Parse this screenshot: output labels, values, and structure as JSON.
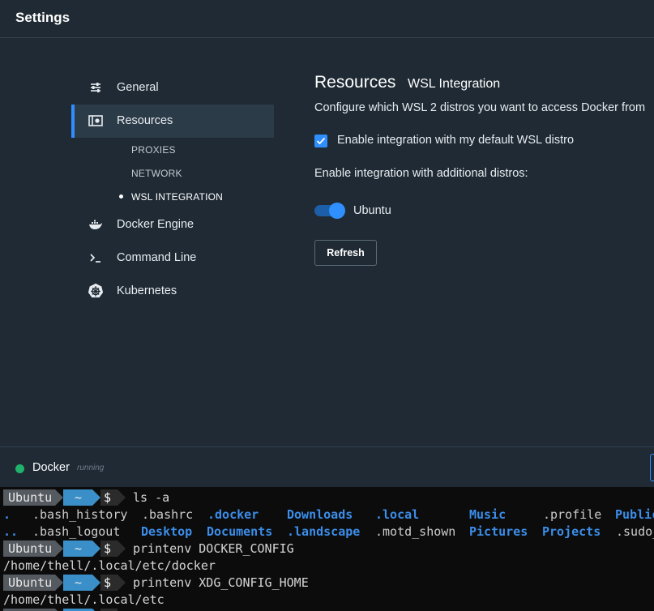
{
  "window": {
    "title": "Settings"
  },
  "sidebar": {
    "items": [
      {
        "label": "General",
        "icon": "sliders-icon"
      },
      {
        "label": "Resources",
        "icon": "resources-icon",
        "active": true
      },
      {
        "label": "Docker Engine",
        "icon": "whale-icon"
      },
      {
        "label": "Command Line",
        "icon": "terminal-prompt-icon"
      },
      {
        "label": "Kubernetes",
        "icon": "kubernetes-helm-icon"
      }
    ],
    "subitems": [
      {
        "label": "PROXIES"
      },
      {
        "label": "NETWORK"
      },
      {
        "label": "WSL INTEGRATION",
        "current": true
      }
    ]
  },
  "main": {
    "title": "Resources",
    "subtitle": "WSL Integration",
    "description": "Configure which WSL 2 distros you want to access Docker from",
    "default_distro_checkbox": {
      "label": "Enable integration with my default WSL distro",
      "checked": true
    },
    "additional_label": "Enable integration with additional distros:",
    "distro_toggle": {
      "label": "Ubuntu",
      "on": true
    },
    "refresh_label": "Refresh"
  },
  "status": {
    "name": "Docker",
    "state": "running",
    "color": "#20b26b"
  },
  "terminal": {
    "prompt": {
      "user": "Ubuntu",
      "path": "~",
      "symbol": "$"
    },
    "commands": [
      "ls -a",
      "printenv DOCKER_CONFIG",
      "printenv XDG_CONFIG_HOME"
    ],
    "ls_row1": [
      ".",
      ".bash_history",
      ".bashrc",
      ".docker",
      "Downloads",
      ".local",
      "Music",
      ".profile",
      "Public"
    ],
    "ls_row2": [
      "..",
      ".bash_logout",
      "Desktop",
      "Documents",
      ".landscape",
      ".motd_shown",
      "Pictures",
      "Projects",
      ".sudo_"
    ],
    "outputs": [
      "/home/thell/.local/etc/docker",
      "/home/thell/.local/etc"
    ]
  },
  "colors": {
    "accent": "#2f8fff",
    "background": "#1f2a34",
    "sidebar_active": "#2c3b48",
    "terminal_bg": "#0c0c0c",
    "directory": "#3b8eea"
  }
}
